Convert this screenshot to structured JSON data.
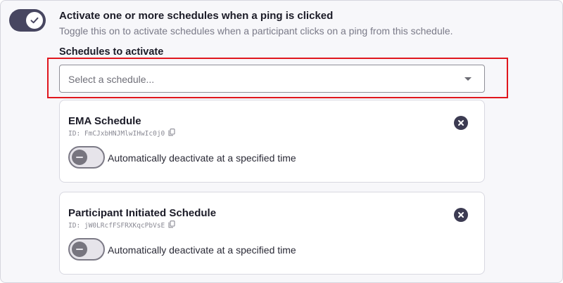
{
  "activate_setting": {
    "title": "Activate one or more schedules when a ping is clicked",
    "description": "Toggle this on to activate schedules when a participant clicks on a ping from this schedule.",
    "enabled": true
  },
  "schedules_section": {
    "label": "Schedules to activate",
    "select_placeholder": "Select a schedule..."
  },
  "schedules": [
    {
      "name": "EMA Schedule",
      "id_text": "ID: FmCJxbHNJMlwIHwIc0j0",
      "auto_deactivate_label": "Automatically deactivate at a specified time",
      "auto_deactivate_enabled": false
    },
    {
      "name": "Participant Initiated Schedule",
      "id_text": "ID: jW0LRcfFSFRXKqcPbVsE",
      "auto_deactivate_label": "Automatically deactivate at a specified time",
      "auto_deactivate_enabled": false
    }
  ],
  "icons": {
    "toggle_check": "check-icon",
    "dropdown": "chevron-down-icon",
    "copy": "copy-icon",
    "remove": "close-circle-icon",
    "toggle_off": "minus-icon"
  },
  "colors": {
    "toggle_on": "#474660",
    "highlight": "#e0161d",
    "remove_button": "#3c3b52"
  }
}
